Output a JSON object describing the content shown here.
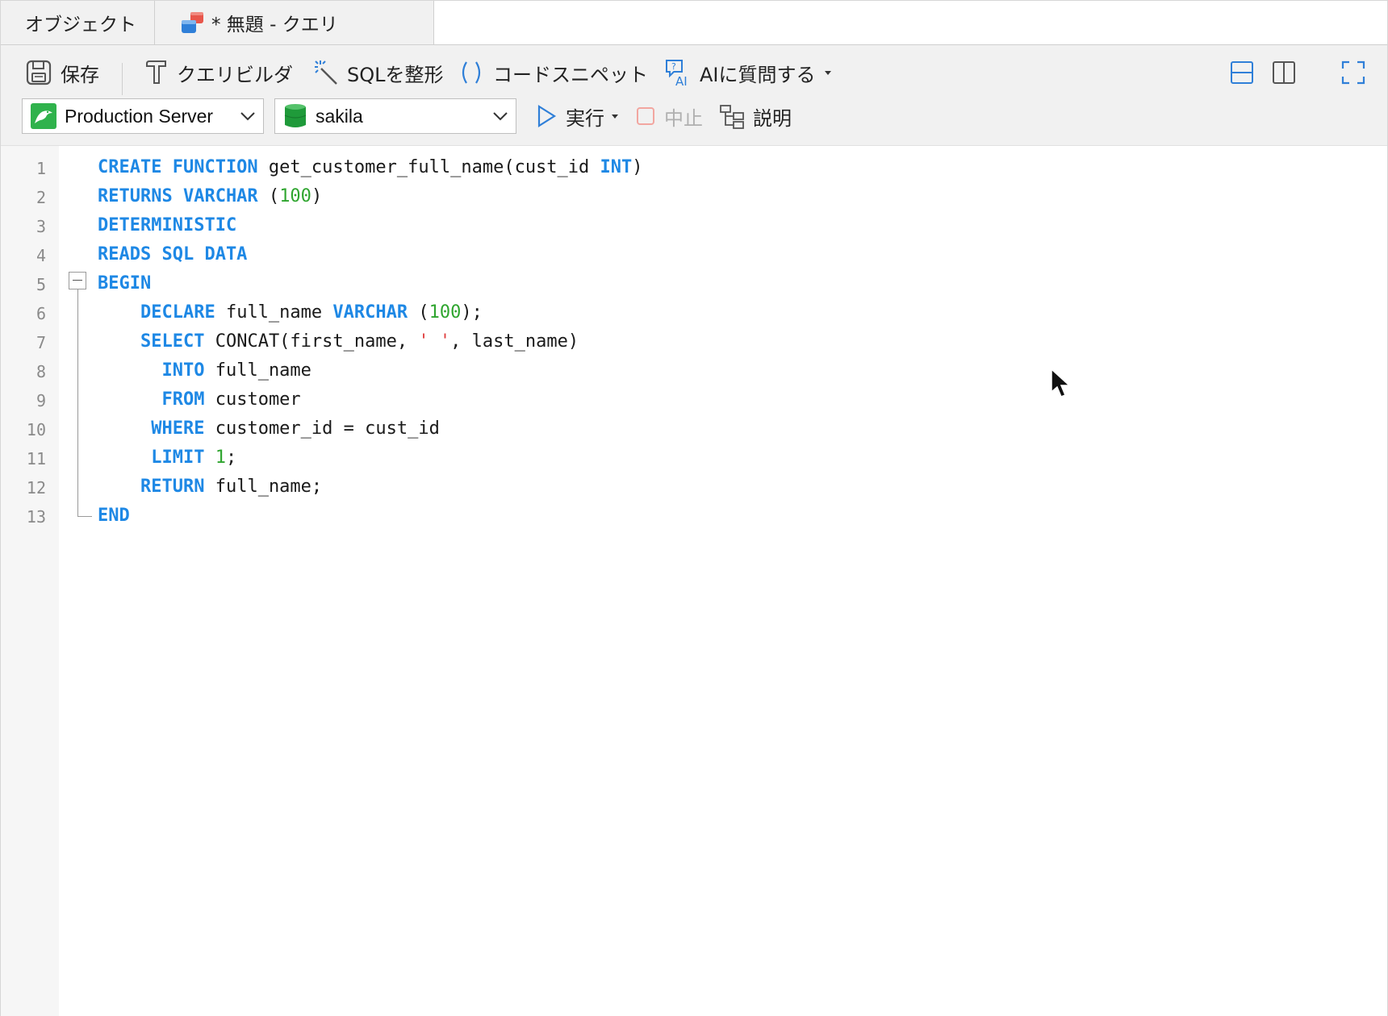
{
  "tabs": [
    {
      "label": "オブジェクト"
    },
    {
      "label": "* 無題 - クエリ"
    }
  ],
  "toolbar": {
    "save": "保存",
    "query_builder": "クエリビルダ",
    "format_sql": "SQLを整形",
    "code_snippet": "コードスニペット",
    "ask_ai": "AIに質問する",
    "run": "実行",
    "stop": "中止",
    "explain": "説明"
  },
  "connection": {
    "selected": "Production Server"
  },
  "database": {
    "selected": "sakila"
  },
  "colors": {
    "keyword": "#1e88e5",
    "number": "#2fa52f",
    "string": "#e04040"
  },
  "editor": {
    "line_numbers": [
      "1",
      "2",
      "3",
      "4",
      "5",
      "6",
      "7",
      "8",
      "9",
      "10",
      "11",
      "12",
      "13"
    ],
    "lines": [
      [
        {
          "t": "CREATE FUNCTION",
          "c": "kw"
        },
        {
          "t": " get_customer_full_name(cust_id "
        },
        {
          "t": "INT",
          "c": "kw"
        },
        {
          "t": ")"
        }
      ],
      [
        {
          "t": "RETURNS VARCHAR",
          "c": "kw"
        },
        {
          "t": " ("
        },
        {
          "t": "100",
          "c": "num"
        },
        {
          "t": ")"
        }
      ],
      [
        {
          "t": "DETERMINISTIC",
          "c": "kw"
        }
      ],
      [
        {
          "t": "READS SQL DATA",
          "c": "kw"
        }
      ],
      [
        {
          "t": "BEGIN",
          "c": "kw"
        }
      ],
      [
        {
          "t": "    "
        },
        {
          "t": "DECLARE",
          "c": "kw"
        },
        {
          "t": " full_name "
        },
        {
          "t": "VARCHAR",
          "c": "kw"
        },
        {
          "t": " ("
        },
        {
          "t": "100",
          "c": "num"
        },
        {
          "t": ");"
        }
      ],
      [
        {
          "t": "    "
        },
        {
          "t": "SELECT",
          "c": "kw"
        },
        {
          "t": " CONCAT(first_name, "
        },
        {
          "t": "' '",
          "c": "str"
        },
        {
          "t": ", last_name)"
        }
      ],
      [
        {
          "t": "      "
        },
        {
          "t": "INTO",
          "c": "kw"
        },
        {
          "t": " full_name"
        }
      ],
      [
        {
          "t": "      "
        },
        {
          "t": "FROM",
          "c": "kw"
        },
        {
          "t": " customer"
        }
      ],
      [
        {
          "t": "     "
        },
        {
          "t": "WHERE",
          "c": "kw"
        },
        {
          "t": " customer_id = cust_id"
        }
      ],
      [
        {
          "t": "     "
        },
        {
          "t": "LIMIT",
          "c": "kw"
        },
        {
          "t": " "
        },
        {
          "t": "1",
          "c": "num"
        },
        {
          "t": ";"
        }
      ],
      [
        {
          "t": "    "
        },
        {
          "t": "RETURN",
          "c": "kw"
        },
        {
          "t": " full_name;"
        }
      ],
      [
        {
          "t": "END",
          "c": "kw"
        }
      ]
    ]
  }
}
